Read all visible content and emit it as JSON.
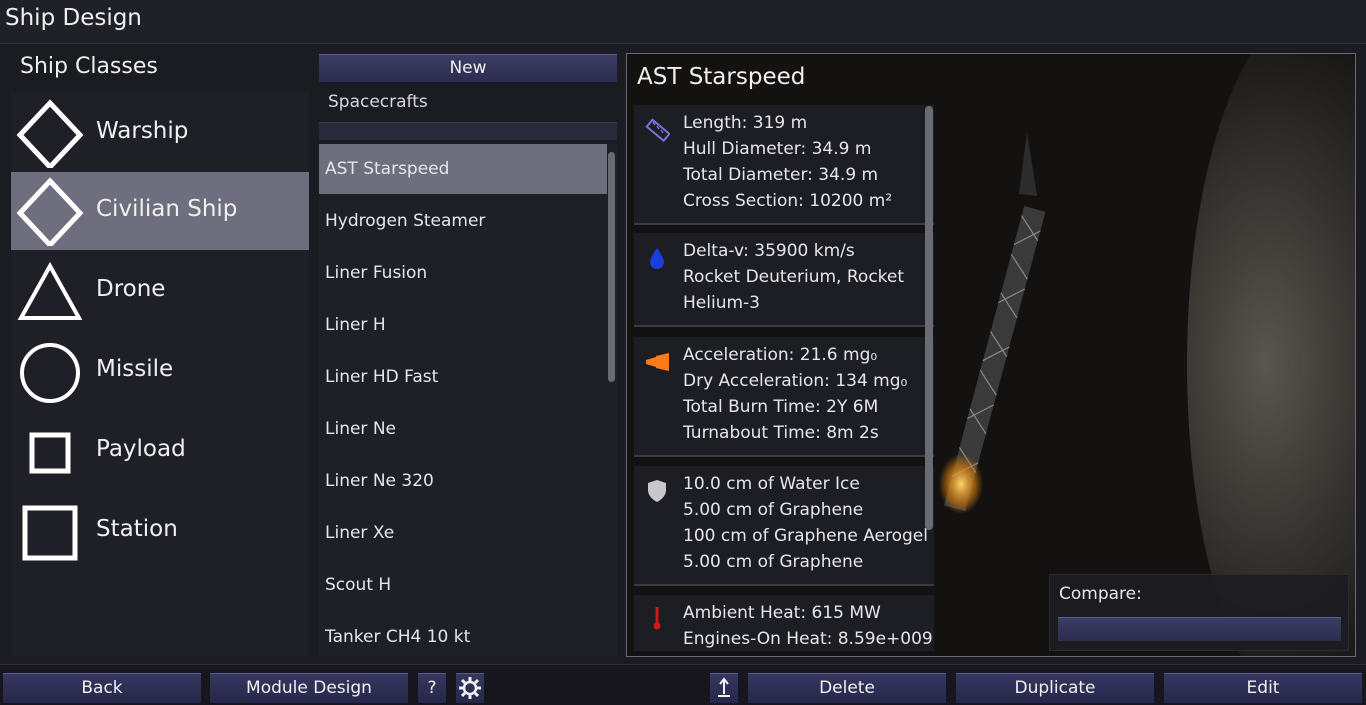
{
  "window": {
    "title": "Ship Design"
  },
  "classes": {
    "title": "Ship Classes",
    "items": [
      {
        "label": "Warship",
        "icon": "diamond-icon"
      },
      {
        "label": "Civilian Ship",
        "icon": "diamond-icon",
        "selected": true
      },
      {
        "label": "Drone",
        "icon": "triangle-icon"
      },
      {
        "label": "Missile",
        "icon": "circle-icon"
      },
      {
        "label": "Payload",
        "icon": "small-square-icon"
      },
      {
        "label": "Station",
        "icon": "square-icon"
      }
    ]
  },
  "list": {
    "new_label": "New",
    "heading": "Spacecrafts",
    "filter_value": "",
    "items": [
      "AST Starspeed",
      "Hydrogen Steamer",
      "Liner Fusion",
      "Liner H",
      "Liner HD Fast",
      "Liner Ne",
      "Liner Ne 320",
      "Liner Xe",
      "Scout H",
      "Tanker CH4 10 kt"
    ]
  },
  "detail": {
    "name": "AST Starspeed",
    "cards": [
      {
        "icon": "ruler-icon",
        "lines": [
          "Length: 319 m",
          "Hull Diameter: 34.9 m",
          "Total Diameter: 34.9 m",
          "Cross Section: 10200 m²"
        ]
      },
      {
        "icon": "fuel-drop-icon",
        "lines": [
          "Delta-v: 35900 km/s",
          "Rocket Deuterium, Rocket",
          "Helium-3"
        ]
      },
      {
        "icon": "engine-thrust-icon",
        "lines": [
          "Acceleration: 21.6 mg₀",
          "Dry Acceleration: 134 mg₀",
          "Total Burn Time: 2Y 6M",
          "Turnabout Time: 8m 2s"
        ]
      },
      {
        "icon": "shield-icon",
        "lines": [
          "10.0 cm of Water Ice",
          "5.00 cm of Graphene",
          "100 cm of Graphene Aerogel",
          "5.00 cm of Graphene"
        ]
      },
      {
        "icon": "thermometer-icon",
        "lines": [
          "Ambient Heat: 615 MW",
          "Engines-On Heat: 8.59e+009"
        ]
      }
    ],
    "compare_label": "Compare:",
    "compare_value": ""
  },
  "toolbar": {
    "back": "Back",
    "module_design": "Module Design",
    "help": "?",
    "settings_icon": "gear-icon",
    "export_icon": "upload-icon",
    "delete": "Delete",
    "duplicate": "Duplicate",
    "edit": "Edit"
  }
}
